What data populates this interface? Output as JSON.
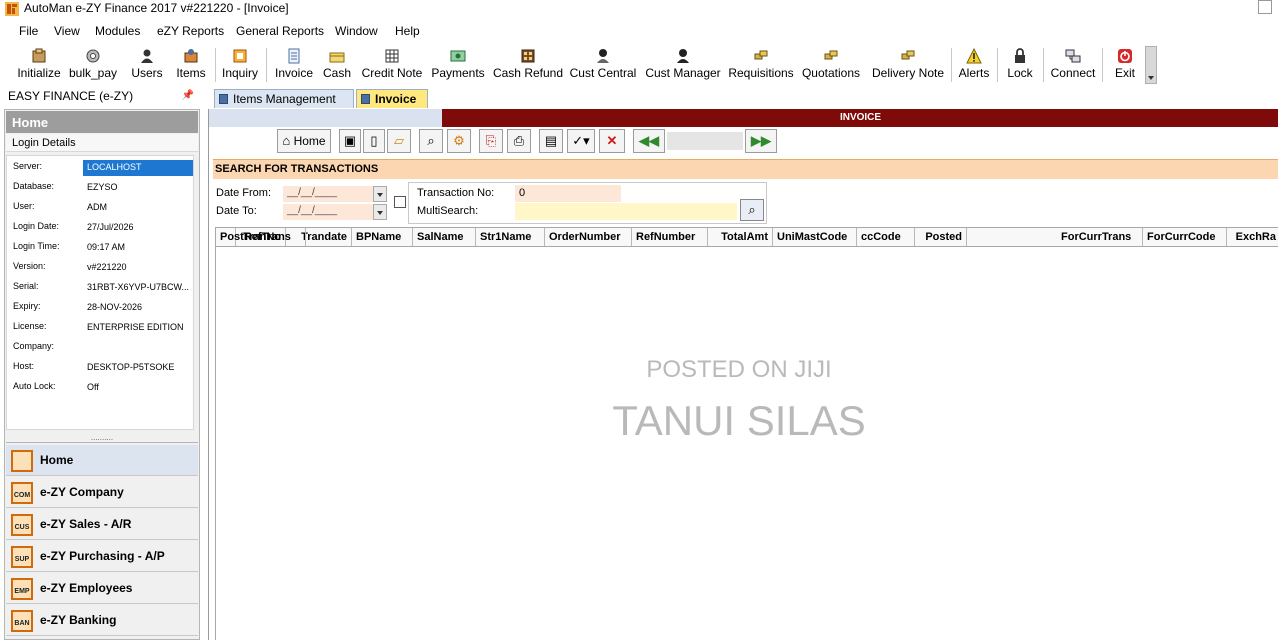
{
  "window": {
    "title": "AutoMan e-ZY Finance 2017  v#221220  - [Invoice]"
  },
  "menu": [
    {
      "label": "File"
    },
    {
      "label": "View"
    },
    {
      "label": "Modules"
    },
    {
      "label": "eZY Reports"
    },
    {
      "label": "General Reports"
    },
    {
      "label": "Window"
    },
    {
      "label": "Help"
    }
  ],
  "toolbar": [
    {
      "label": "Initialize",
      "icon": "initialize-icon"
    },
    {
      "label": "bulk_pay",
      "icon": "gear-icon"
    },
    {
      "label": "Users",
      "icon": "users-icon"
    },
    {
      "label": "Items",
      "icon": "items-icon"
    },
    {
      "label": "Inquiry",
      "icon": "inquiry-icon"
    },
    {
      "label": "Invoice",
      "icon": "invoice-icon"
    },
    {
      "label": "Cash",
      "icon": "cash-icon"
    },
    {
      "label": "Credit Note",
      "icon": "credit-note-icon"
    },
    {
      "label": "Payments",
      "icon": "payments-icon"
    },
    {
      "label": "Cash Refund",
      "icon": "cash-refund-icon"
    },
    {
      "label": "Cust Central",
      "icon": "cust-central-icon"
    },
    {
      "label": "Cust Manager",
      "icon": "cust-manager-icon"
    },
    {
      "label": "Requisitions",
      "icon": "requisitions-icon"
    },
    {
      "label": "Quotations",
      "icon": "quotations-icon"
    },
    {
      "label": "Delivery Note",
      "icon": "delivery-note-icon"
    },
    {
      "label": "Alerts",
      "icon": "alert-icon"
    },
    {
      "label": "Lock",
      "icon": "lock-icon"
    },
    {
      "label": "Connect",
      "icon": "connect-icon"
    },
    {
      "label": "Exit",
      "icon": "exit-icon"
    }
  ],
  "tabs": {
    "panel_caption": "EASY FINANCE (e-ZY)",
    "items": [
      {
        "label": "Items Management"
      },
      {
        "label": "Invoice"
      }
    ]
  },
  "sidebar": {
    "header": "Home",
    "subheader": "Login Details",
    "login": [
      {
        "key": "Server:",
        "value": "LOCALHOST"
      },
      {
        "key": "Database:",
        "value": "EZYSO"
      },
      {
        "key": "User:",
        "value": "ADM"
      },
      {
        "key": "Login Date:",
        "value": "27/Jul/2026"
      },
      {
        "key": "Login Time:",
        "value": "09:17 AM"
      },
      {
        "key": "Version:",
        "value": " v#221220"
      },
      {
        "key": "Serial:",
        "value": "31RBT-X6YVP-U7BCW..."
      },
      {
        "key": "Expiry:",
        "value": "28-NOV-2026"
      },
      {
        "key": "License:",
        "value": "ENTERPRISE EDITION"
      },
      {
        "key": "Company:",
        "value": ""
      },
      {
        "key": "Host:",
        "value": "DESKTOP-P5TSOKE"
      },
      {
        "key": "Auto Lock:",
        "value": "Off"
      }
    ],
    "splitter": "..........",
    "nav": [
      {
        "label": "Home",
        "badge": ""
      },
      {
        "label": "e-ZY Company",
        "badge": "COM"
      },
      {
        "label": "e-ZY Sales - A/R",
        "badge": "CUS"
      },
      {
        "label": "e-ZY Purchasing - A/P",
        "badge": "SUP"
      },
      {
        "label": "e-ZY Employees",
        "badge": "EMP"
      },
      {
        "label": "e-ZY Banking",
        "badge": "BAN"
      }
    ]
  },
  "invoice": {
    "banner": "INVOICE",
    "home_label": "Home",
    "search_title": "SEARCH FOR TRANSACTIONS",
    "date_from_label": "Date From:",
    "date_to_label": "Date To:",
    "date_from_value": "__/__/____",
    "date_to_value": "__/__/____",
    "transaction_no_label": "Transaction No:",
    "transaction_no_value": "0",
    "multisearch_label": "MultiSearch:",
    "multisearch_value": "",
    "columns": [
      "TranNo",
      "Trandate",
      "BPName",
      "SalName",
      "Str1Name",
      "OrderNumber",
      "RefNumber",
      "TotalAmt",
      "UniMastCode",
      "ccCode",
      "Posted",
      "PostRefTrans",
      "ForCurrTrans",
      "ForCurrCode",
      "ExchRa"
    ]
  },
  "watermark": {
    "line1": "POSTED ON JIJI",
    "line2": "TANUI SILAS"
  },
  "colors": {
    "invoice_banner": "#7e0a0a",
    "search_header": "#fbd6b0",
    "selected_value": "#1e78d2",
    "active_tab": "#ffe97f"
  }
}
